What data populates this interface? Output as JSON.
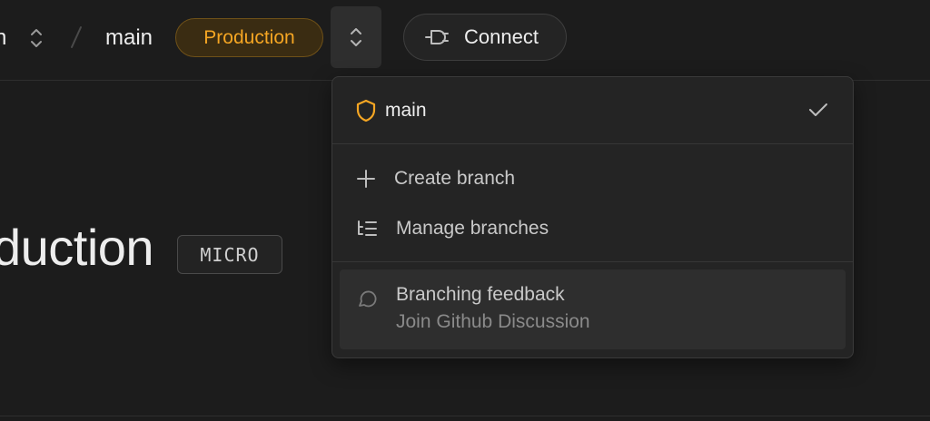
{
  "header": {
    "org_name_partial": "n",
    "branch": "main",
    "environment_badge": "Production",
    "connect_label": "Connect"
  },
  "page": {
    "title_partial": "duction",
    "compute_badge": "MICRO"
  },
  "branch_dropdown": {
    "current_branch": "main",
    "actions": [
      {
        "label": "Create branch",
        "icon": "plus-icon"
      },
      {
        "label": "Manage branches",
        "icon": "branch-list-icon"
      }
    ],
    "feedback": {
      "title": "Branching feedback",
      "subtitle": "Join Github Discussion",
      "icon": "speech-bubble-icon"
    }
  },
  "colors": {
    "background": "#1c1c1c",
    "badge_warning": "#f5a623",
    "dropdown_bg": "#242424",
    "highlight_bg": "#2e2e2e"
  }
}
